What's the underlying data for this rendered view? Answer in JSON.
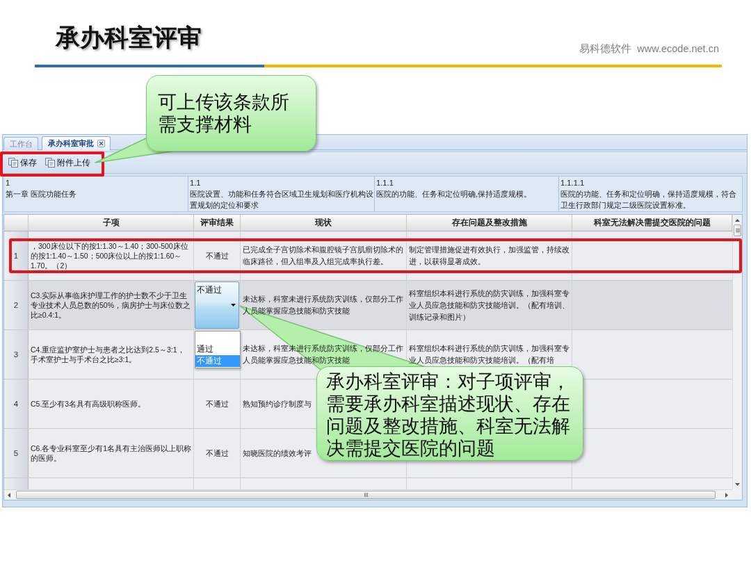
{
  "header": {
    "title": "承办科室评审",
    "brand": "易科德软件",
    "website": "www.ecode.net.cn"
  },
  "app": {
    "tabs": [
      {
        "label": "工作台",
        "selected": false,
        "closable": false
      },
      {
        "label": "承办科室审批",
        "selected": true,
        "closable": true
      }
    ],
    "toolbar": {
      "highlighted": true,
      "buttons": [
        {
          "label": "保存"
        },
        {
          "label": "附件上传"
        }
      ]
    },
    "sections": [
      {
        "number": "1",
        "title": "第一章 医院功能任务"
      },
      {
        "number": "1.1",
        "title": "医院设置、功能和任务符合区域卫生规划和医疗机构设置规划的定位和要求"
      },
      {
        "number": "1.1.1",
        "title": "医院的功能、任务和定位明确,保持适度规模。"
      },
      {
        "number": "1.1.1.1",
        "title": "医院的功能、任务和定位明确，保持适度规模，符合卫生行政部门规定二级医院设置标准。"
      }
    ],
    "grid": {
      "columns": [
        "子项",
        "评审结果",
        "现状",
        "存在问题及整改措施",
        "科室无法解决需提交医院的问题"
      ],
      "rows": [
        {
          "number": "1",
          "selected": false,
          "highlighted": true,
          "item": "，300床位以下的按1:1.30～1.40；300-500床位的按1:1.40～1.50；500床位以上的按1:1.60～1.70。（2）",
          "result": {
            "kind": "text",
            "value": "不通过"
          },
          "status": "已完成全子宫切除术和腹腔镜子宫肌瘤切除术的临床路径，但入组率及入组完成率执行差。",
          "measures": "制定管理措施促进有效执行，加强监管，持续改进，以获得显著成效。"
        },
        {
          "number": "2",
          "selected": true,
          "highlighted": false,
          "item": "C3.实际从事临床护理工作的护士数不少于卫生专业技术人员总数的50%，病房护士与床位数之比≥0.4:1。",
          "result": {
            "kind": "select",
            "value": "不通过",
            "expanded": true,
            "options": [
              {
                "label": "通过",
                "selected": false
              },
              {
                "label": "不通过",
                "selected": true
              }
            ]
          },
          "status": "未达标，科室未进行系统防灾训练，仅部分工作人员能掌握应急技能和防灾技能",
          "measures": "科室组织本科进行系统的防灾训练，加强科室专业人员应急技能和防灾技能培训。（配有培训、训练记录和图片）"
        },
        {
          "number": "3",
          "selected": false,
          "highlighted": false,
          "item": "C4.重症监护室护士与患者之比达到2.5～3:1，手术室护士与手术台之比≥3:1。",
          "status": "未达标，科室未进行系统防灾训练，仅部分工作人员能掌握应急技能和防灾技能",
          "measures": "科室组织本科进行系统的防灾训练，加强科室专业人员应急技能和防灾技能培训。（配有培"
        },
        {
          "number": "4",
          "selected": false,
          "highlighted": false,
          "item": "C5.至少有3名具有高级职称医师。",
          "result": {
            "kind": "text",
            "value": "不通过"
          },
          "status": "熟知预约诊疗制度与"
        },
        {
          "number": "5",
          "selected": false,
          "highlighted": false,
          "item": "C6.各专业科室至少有1名具有主治医师以上职称的医师。",
          "result": {
            "kind": "text",
            "value": "不通过"
          },
          "status": "知晓医院的绩效考评"
        }
      ]
    }
  },
  "callouts": [
    {
      "kind": "toolbar",
      "text": "可上传该条款所需支撑材料"
    },
    {
      "kind": "grid",
      "text": "承办科室评审：对子项评审，需要承办科室描述现状、存在问题及整改措施、科室无法解决需提交医院的问题"
    }
  ]
}
